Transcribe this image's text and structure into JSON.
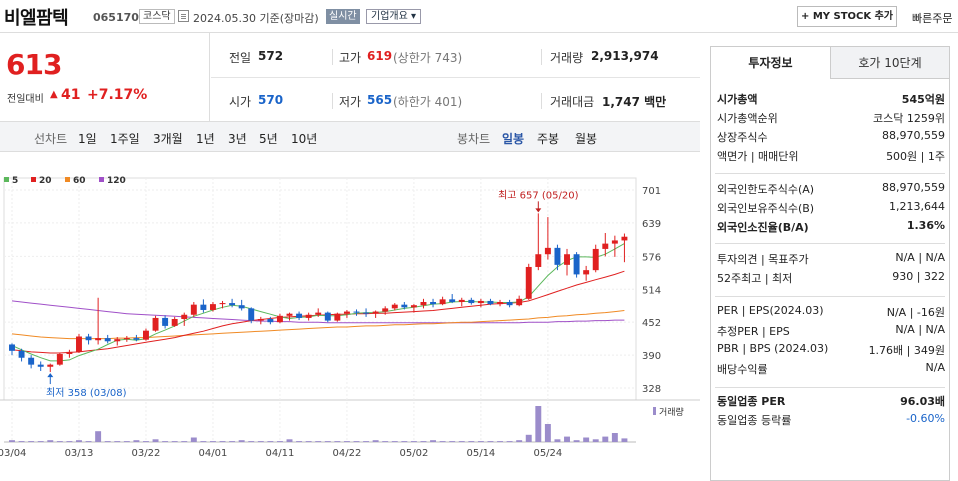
{
  "header": {
    "stock_name": "비엘팜텍",
    "stock_code": "065170",
    "market": "코스닥",
    "date_text": "2024.05.30  기준(장마감)",
    "realtime": "실시간",
    "company_info": "기업개요 ▾",
    "mystock_btn": "+ MY STOCK 추가",
    "quick_order": "빠른주문"
  },
  "price": {
    "current": "613",
    "change_label": "전일대비",
    "change_arrow": "▲",
    "change_value": "41",
    "change_pct": "+7.17%"
  },
  "quote": {
    "prev_close_label": "전일",
    "prev_close": "572",
    "high_label": "고가",
    "high": "619",
    "upper_limit": "(상한가 743)",
    "volume_label": "거래량",
    "volume": "2,913,974",
    "open_label": "시가",
    "open": "570",
    "low_label": "저가",
    "low": "565",
    "lower_limit": "(하한가 401)",
    "amount_label": "거래대금",
    "amount": "1,747 백만"
  },
  "periods": {
    "line_chart": "선차트",
    "items": [
      "1일",
      "1주일",
      "3개월",
      "1년",
      "3년",
      "5년",
      "10년"
    ],
    "candle_chart": "봉차트",
    "candle_items": [
      "일봉",
      "주봉",
      "월봉"
    ],
    "selected": "일봉"
  },
  "chart_data": {
    "type": "candlestick",
    "legend": [
      {
        "name": "5",
        "color": "#5cb85c"
      },
      {
        "name": "20",
        "color": "#e02020"
      },
      {
        "name": "60",
        "color": "#f08a24"
      },
      {
        "name": "120",
        "color": "#a050c8"
      }
    ],
    "y_ticks": [
      701,
      639,
      576,
      514,
      452,
      390,
      328
    ],
    "ylim": [
      328,
      701
    ],
    "x_ticks": [
      "03/04",
      "03/13",
      "03/22",
      "04/01",
      "04/11",
      "04/22",
      "05/02",
      "05/14",
      "05/24"
    ],
    "high_annotation": "최고 657 (05/20)",
    "low_annotation": "최저 358 (03/08)",
    "volume_label": "거래량",
    "candles": [
      [
        410,
        412,
        390,
        398
      ],
      [
        398,
        402,
        378,
        385
      ],
      [
        385,
        390,
        365,
        372
      ],
      [
        372,
        378,
        360,
        368
      ],
      [
        368,
        374,
        358,
        372
      ],
      [
        372,
        395,
        370,
        392
      ],
      [
        392,
        400,
        385,
        396
      ],
      [
        396,
        430,
        394,
        425
      ],
      [
        425,
        430,
        410,
        418
      ],
      [
        418,
        498,
        410,
        422
      ],
      [
        422,
        428,
        412,
        416
      ],
      [
        416,
        424,
        408,
        420
      ],
      [
        420,
        426,
        415,
        422
      ],
      [
        422,
        428,
        416,
        419
      ],
      [
        419,
        440,
        417,
        436
      ],
      [
        436,
        464,
        434,
        460
      ],
      [
        460,
        465,
        440,
        445
      ],
      [
        445,
        462,
        443,
        458
      ],
      [
        458,
        470,
        445,
        466
      ],
      [
        466,
        490,
        462,
        485
      ],
      [
        485,
        495,
        470,
        475
      ],
      [
        475,
        490,
        472,
        486
      ],
      [
        486,
        492,
        478,
        488
      ],
      [
        488,
        496,
        480,
        484
      ],
      [
        484,
        494,
        474,
        478
      ],
      [
        478,
        480,
        450,
        455
      ],
      [
        455,
        462,
        448,
        458
      ],
      [
        458,
        462,
        448,
        452
      ],
      [
        452,
        468,
        450,
        464
      ],
      [
        464,
        470,
        455,
        468
      ],
      [
        468,
        472,
        456,
        460
      ],
      [
        460,
        470,
        455,
        466
      ],
      [
        466,
        478,
        462,
        470
      ],
      [
        470,
        472,
        452,
        455
      ],
      [
        455,
        470,
        453,
        468
      ],
      [
        468,
        475,
        460,
        472
      ],
      [
        472,
        476,
        464,
        470
      ],
      [
        470,
        478,
        462,
        468
      ],
      [
        468,
        474,
        460,
        472
      ],
      [
        472,
        482,
        466,
        478
      ],
      [
        478,
        488,
        474,
        485
      ],
      [
        485,
        490,
        476,
        480
      ],
      [
        480,
        486,
        470,
        484
      ],
      [
        484,
        496,
        478,
        490
      ],
      [
        490,
        496,
        480,
        486
      ],
      [
        486,
        500,
        484,
        495
      ],
      [
        495,
        505,
        488,
        490
      ],
      [
        490,
        498,
        482,
        494
      ],
      [
        494,
        498,
        485,
        488
      ],
      [
        488,
        496,
        480,
        492
      ],
      [
        492,
        496,
        484,
        486
      ],
      [
        486,
        494,
        482,
        490
      ],
      [
        490,
        494,
        480,
        484
      ],
      [
        484,
        502,
        482,
        496
      ],
      [
        496,
        562,
        494,
        556
      ],
      [
        556,
        657,
        550,
        580
      ],
      [
        580,
        650,
        570,
        592
      ],
      [
        592,
        598,
        550,
        560
      ],
      [
        560,
        590,
        540,
        580
      ],
      [
        580,
        584,
        536,
        542
      ],
      [
        542,
        558,
        530,
        550
      ],
      [
        550,
        598,
        546,
        590
      ],
      [
        590,
        620,
        576,
        600
      ],
      [
        600,
        615,
        575,
        606
      ],
      [
        606,
        619,
        565,
        613
      ]
    ],
    "ma5": [
      408,
      400,
      392,
      385,
      379,
      379,
      381,
      389,
      395,
      401,
      410,
      418,
      420,
      418,
      421,
      430,
      437,
      445,
      454,
      463,
      469,
      475,
      480,
      484,
      482,
      477,
      472,
      467,
      462,
      459,
      461,
      462,
      465,
      464,
      464,
      466,
      469,
      470,
      470,
      472,
      475,
      478,
      480,
      483,
      486,
      487,
      490,
      491,
      491,
      490,
      490,
      489,
      489,
      490,
      500,
      520,
      540,
      556,
      568,
      575,
      575,
      574,
      580,
      590,
      600
    ],
    "ma20": [
      400,
      398,
      396,
      395,
      394,
      394,
      395,
      396,
      398,
      400,
      402,
      405,
      408,
      411,
      414,
      417,
      420,
      423,
      427,
      431,
      435,
      440,
      445,
      449,
      452,
      455,
      457,
      459,
      461,
      462,
      463,
      464,
      465,
      466,
      467,
      467,
      468,
      468,
      469,
      469,
      470,
      471,
      472,
      473,
      474,
      476,
      478,
      480,
      482,
      484,
      486,
      487,
      488,
      489,
      492,
      498,
      504,
      510,
      516,
      522,
      527,
      532,
      537,
      542,
      548
    ],
    "ma60": [
      430,
      428,
      426,
      424,
      423,
      422,
      421,
      421,
      421,
      421,
      421,
      422,
      422,
      423,
      423,
      424,
      425,
      426,
      427,
      428,
      429,
      430,
      431,
      432,
      433,
      434,
      435,
      436,
      437,
      438,
      439,
      440,
      441,
      442,
      443,
      443,
      444,
      445,
      445,
      446,
      447,
      447,
      448,
      449,
      449,
      450,
      451,
      452,
      452,
      453,
      454,
      455,
      456,
      457,
      458,
      460,
      461,
      463,
      464,
      466,
      467,
      469,
      470,
      472,
      474
    ],
    "ma120": [
      492,
      490,
      488,
      486,
      484,
      482,
      480,
      478,
      476,
      474,
      472,
      470,
      468,
      467,
      466,
      465,
      464,
      463,
      462,
      461,
      460,
      459,
      458,
      457,
      456,
      455,
      454,
      454,
      453,
      453,
      452,
      452,
      452,
      451,
      451,
      451,
      451,
      451,
      451,
      451,
      451,
      451,
      451,
      451,
      451,
      451,
      451,
      451,
      451,
      451,
      451,
      451,
      451,
      451,
      452,
      452,
      452,
      453,
      453,
      454,
      454,
      455,
      455,
      456,
      456
    ],
    "volume": [
      2,
      1,
      1,
      1,
      2,
      1,
      1,
      2,
      1,
      12,
      1,
      1,
      1,
      2,
      1,
      3,
      1,
      1,
      1,
      5,
      1,
      1,
      1,
      1,
      2,
      1,
      1,
      1,
      1,
      3,
      1,
      1,
      1,
      1,
      1,
      1,
      1,
      1,
      2,
      1,
      1,
      1,
      1,
      1,
      2,
      1,
      1,
      1,
      1,
      1,
      1,
      1,
      1,
      2,
      8,
      40,
      20,
      3,
      6,
      2,
      5,
      3,
      6,
      10,
      4
    ],
    "x_tick_indices": [
      0,
      7,
      14,
      21,
      28,
      35,
      42,
      49,
      56
    ]
  },
  "right_panel": {
    "tab_invest": "투자정보",
    "tab_hoga": "호가 10단계",
    "rows1": [
      {
        "l": "시가총액",
        "r": "545억원",
        "bold": true
      },
      {
        "l": "시가총액순위",
        "r": "코스닥 1259위"
      },
      {
        "l": "상장주식수",
        "r": "88,970,559"
      },
      {
        "l": "액면가 | 매매단위",
        "r": "500원 | 1주"
      }
    ],
    "rows2": [
      {
        "l": "외국인한도주식수(A)",
        "r": "88,970,559"
      },
      {
        "l": "외국인보유주식수(B)",
        "r": "1,213,644"
      },
      {
        "l": "외국인소진율(B/A)",
        "r": "1.36%",
        "bold": true
      }
    ],
    "rows3": [
      {
        "l": "투자의견 | 목표주가",
        "r": "N/A | N/A"
      },
      {
        "l": "52주최고 | 최저",
        "r": "930 | 322"
      }
    ],
    "rows4": [
      {
        "l": "PER | EPS(2024.03)",
        "r": "N/A | -16원"
      },
      {
        "l": "추정PER | EPS",
        "r": "N/A | N/A"
      },
      {
        "l": "PBR | BPS (2024.03)",
        "r": "1.76배 | 349원"
      },
      {
        "l": "배당수익률",
        "r": "N/A"
      }
    ],
    "rows5": [
      {
        "l": "동일업종 PER",
        "r": "96.03배",
        "bold": true
      },
      {
        "l": "동일업종 등락률",
        "r": "-0.60%",
        "blue": true
      }
    ]
  }
}
